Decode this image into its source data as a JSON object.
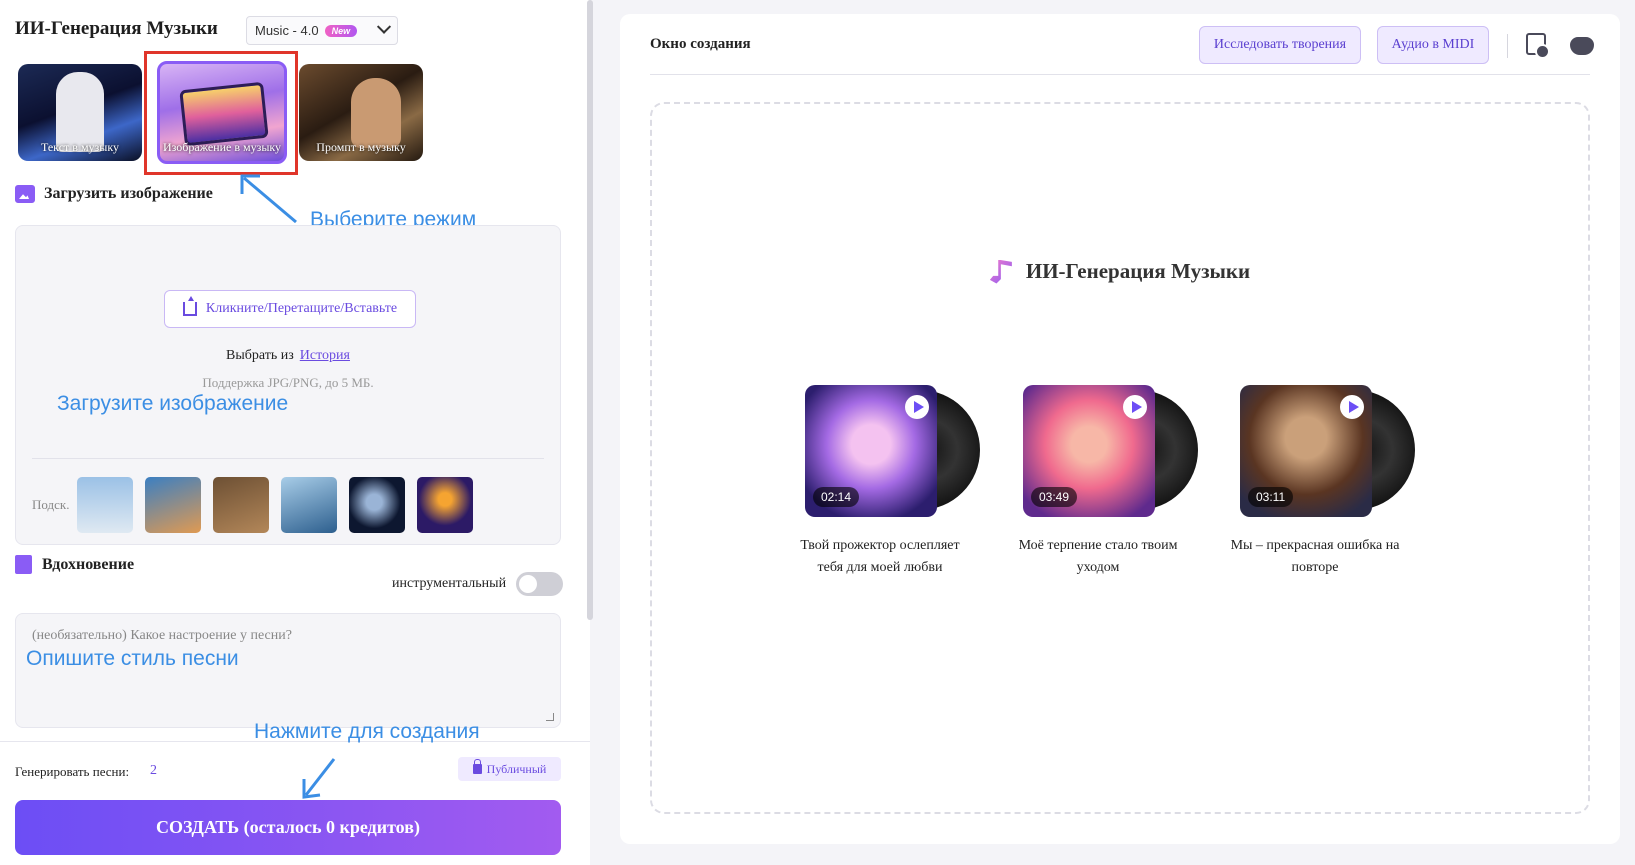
{
  "app": {
    "title": "ИИ-Генерация Музыки"
  },
  "version": {
    "label": "Music - 4.0",
    "badge": "New"
  },
  "modes": [
    {
      "label": "Текст в музыку"
    },
    {
      "label": "Изображение в музыку"
    },
    {
      "label": "Промпт в музыку"
    }
  ],
  "annotations": {
    "select_mode": "Выберите режим Изображение в музыку",
    "upload": "Загрузите изображение",
    "describe": "Опишите стиль песни",
    "click_create": "Нажмите для создания"
  },
  "upload": {
    "title": "Загрузить изображение",
    "button": "Кликните/Перетащите/Вставьте",
    "choose_from": "Выбрать из",
    "history_link": "История",
    "support": "Поддержка JPG/PNG, до 5 МБ.",
    "hints_label": "Подск."
  },
  "inspiration": {
    "title": "Вдохновение",
    "instrumental": "инструментальный",
    "placeholder": "(необязательно) Какое настроение у песни?"
  },
  "generate": {
    "label": "Генерировать песни:",
    "count": "2",
    "public": "Публичный",
    "create": "СОЗДАТЬ (осталось 0 кредитов)"
  },
  "window": {
    "title": "Окно создания",
    "explore": "Исследовать творения",
    "midi": "Аудио в MIDI",
    "center_title": "ИИ-Генерация Музыки"
  },
  "songs": [
    {
      "duration": "02:14",
      "title": "Твой прожектор ослепляет тебя для моей любви"
    },
    {
      "duration": "03:49",
      "title": "Моё терпение стало твоим уходом"
    },
    {
      "duration": "03:11",
      "title": "Мы – прекрасная ошибка на повторе"
    }
  ],
  "colors": {
    "accent": "#6c4ef5",
    "annotation": "#3b8ee4",
    "highlight_box": "#e0352a"
  }
}
